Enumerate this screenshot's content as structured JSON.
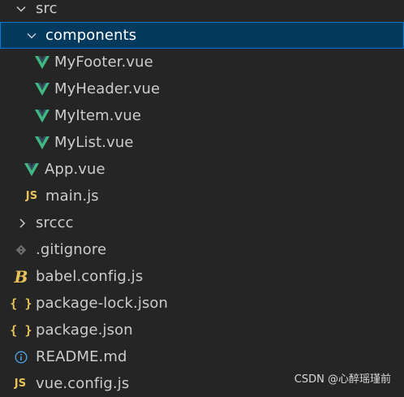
{
  "explorer": {
    "items": [
      {
        "label": "src",
        "type": "folder-open"
      },
      {
        "label": "components",
        "type": "folder-open",
        "selected": true
      },
      {
        "label": "MyFooter.vue",
        "type": "vue"
      },
      {
        "label": "MyHeader.vue",
        "type": "vue"
      },
      {
        "label": "MyItem.vue",
        "type": "vue"
      },
      {
        "label": "MyList.vue",
        "type": "vue"
      },
      {
        "label": "App.vue",
        "type": "vue"
      },
      {
        "label": "main.js",
        "type": "js"
      },
      {
        "label": "srccc",
        "type": "folder-closed"
      },
      {
        "label": ".gitignore",
        "type": "git"
      },
      {
        "label": "babel.config.js",
        "type": "babel"
      },
      {
        "label": "package-lock.json",
        "type": "json"
      },
      {
        "label": "package.json",
        "type": "json"
      },
      {
        "label": "README.md",
        "type": "info"
      },
      {
        "label": "vue.config.js",
        "type": "js"
      }
    ],
    "icon_glyphs": {
      "js": "JS",
      "json": "{ }",
      "babel": "B"
    }
  },
  "watermark": "CSDN @心醉瑶瑾前",
  "colors": {
    "background": "#252526",
    "selected_row": "#04395e",
    "selected_border": "#0078d4",
    "vue_green": "#41b883",
    "js_yellow": "#e8c35a",
    "info_blue": "#4ea1e0",
    "git_grey": "#6b6b6b",
    "text": "#cccccc"
  }
}
